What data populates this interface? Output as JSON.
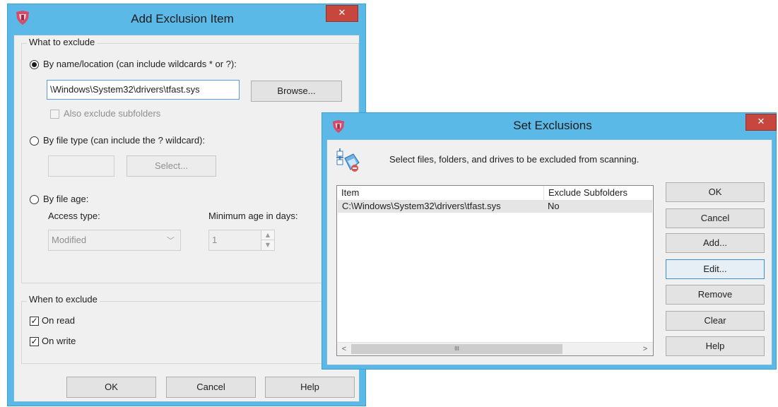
{
  "add_dialog": {
    "title": "Add Exclusion Item",
    "close_symbol": "✕",
    "what_group_label": "What to exclude",
    "radio_name_label": "By name/location (can include wildcards * or ?):",
    "path_value": "\\Windows\\System32\\drivers\\tfast.sys",
    "browse_label": "Browse...",
    "subfolders_label": "Also exclude subfolders",
    "radio_type_label": "By file type (can include the ? wildcard):",
    "filetype_value": "",
    "select_label": "Select...",
    "radio_age_label": "By file age:",
    "access_type_label": "Access type:",
    "access_type_value": "Modified",
    "min_age_label": "Minimum age in days:",
    "min_age_value": "1",
    "when_group_label": "When to exclude",
    "on_read_label": "On read",
    "on_write_label": "On write",
    "ok_label": "OK",
    "cancel_label": "Cancel",
    "help_label": "Help"
  },
  "set_dialog": {
    "title": "Set Exclusions",
    "close_symbol": "✕",
    "description": "Select files, folders, and drives to be excluded from scanning.",
    "columns": [
      "Item",
      "Exclude Subfolders"
    ],
    "rows": [
      {
        "item": "C:\\Windows\\System32\\drivers\\tfast.sys",
        "subfolders": "No"
      }
    ],
    "scroll_left": "<",
    "scroll_right": ">",
    "scroll_thumb": "III",
    "buttons": {
      "ok": "OK",
      "cancel": "Cancel",
      "add": "Add...",
      "edit": "Edit...",
      "remove": "Remove",
      "clear": "Clear",
      "help": "Help"
    }
  },
  "colors": {
    "title_bar": "#5bb9e8",
    "close_button": "#c7463d",
    "client": "#f0f0f0"
  }
}
